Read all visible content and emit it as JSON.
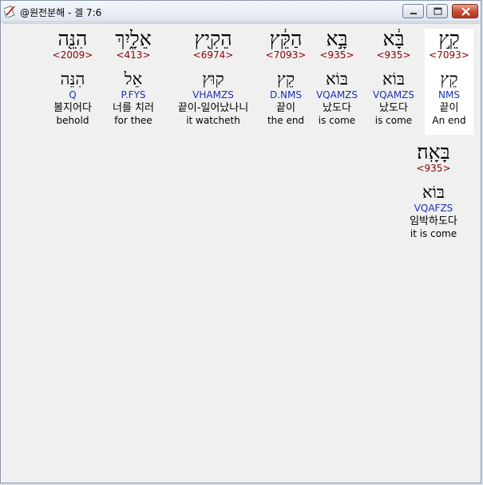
{
  "window": {
    "title": "@원전분해 - 겔 7:6",
    "app_icon": "bible-app-icon",
    "controls": [
      "minimize-icon",
      "maximize-icon",
      "close-icon"
    ]
  },
  "words": [
    {
      "hebrew": "קֵ֣ץ",
      "strong": "<7093>",
      "root": "קֵץ",
      "morph": "NMS",
      "korean": "끝이",
      "english": "An end"
    },
    {
      "hebrew": "בָּ֔א",
      "strong": "<935>",
      "root": "בּוֹא",
      "morph": "VQAMZS",
      "korean": "났도다",
      "english": "is come"
    },
    {
      "hebrew": "בָּ֣א",
      "strong": "<935>",
      "root": "בּוֹא",
      "morph": "VQAMZS",
      "korean": "났도다",
      "english": "is come"
    },
    {
      "hebrew": "הַקֵּ֔ץ",
      "strong": "<7093>",
      "root": "קֵץ",
      "morph": "D.NMS",
      "korean": "끝이",
      "english": "the end"
    },
    {
      "hebrew": "הֵקִ֖יץ",
      "strong": "<6974>",
      "root": "קוּץ",
      "morph": "VHAMZS",
      "korean": "끝이-일어났나니",
      "english": "it watcheth"
    },
    {
      "hebrew": "אֵלָ֑יִךְ",
      "strong": "<413>",
      "root": "אֵל",
      "morph": "P.FYS",
      "korean": "너를 치러",
      "english": "for thee"
    },
    {
      "hebrew": "הִנֵּ֖ה",
      "strong": "<2009>",
      "root": "הִנֵּה",
      "morph": "Q",
      "korean": "볼지어다",
      "english": "behold"
    },
    {
      "hebrew": "בָּאָֽה׃",
      "strong": "<935>",
      "root": "בּוֹא",
      "morph": "VQAFZS",
      "korean": "임박하도다",
      "english": "it is come"
    }
  ]
}
